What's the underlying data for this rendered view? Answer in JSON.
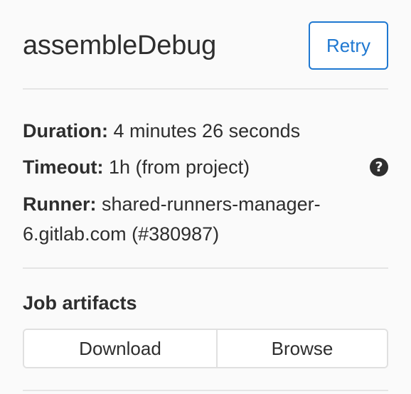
{
  "job": {
    "title": "assembleDebug",
    "retry_label": "Retry"
  },
  "info": {
    "duration_label": "Duration:",
    "duration_value": "4 minutes 26 seconds",
    "timeout_label": "Timeout:",
    "timeout_value": "1h (from project)",
    "timeout_help_icon": "question-circle-icon",
    "runner_label": "Runner:",
    "runner_value_line1": "shared-runners-manager-",
    "runner_value_line2": "6.gitlab.com (#380987)"
  },
  "artifacts": {
    "title": "Job artifacts",
    "download_label": "Download",
    "browse_label": "Browse"
  },
  "colors": {
    "accent": "#1f78d1",
    "text": "#2e2e2e",
    "background": "#fafafa",
    "divider": "#e5e5e5"
  }
}
